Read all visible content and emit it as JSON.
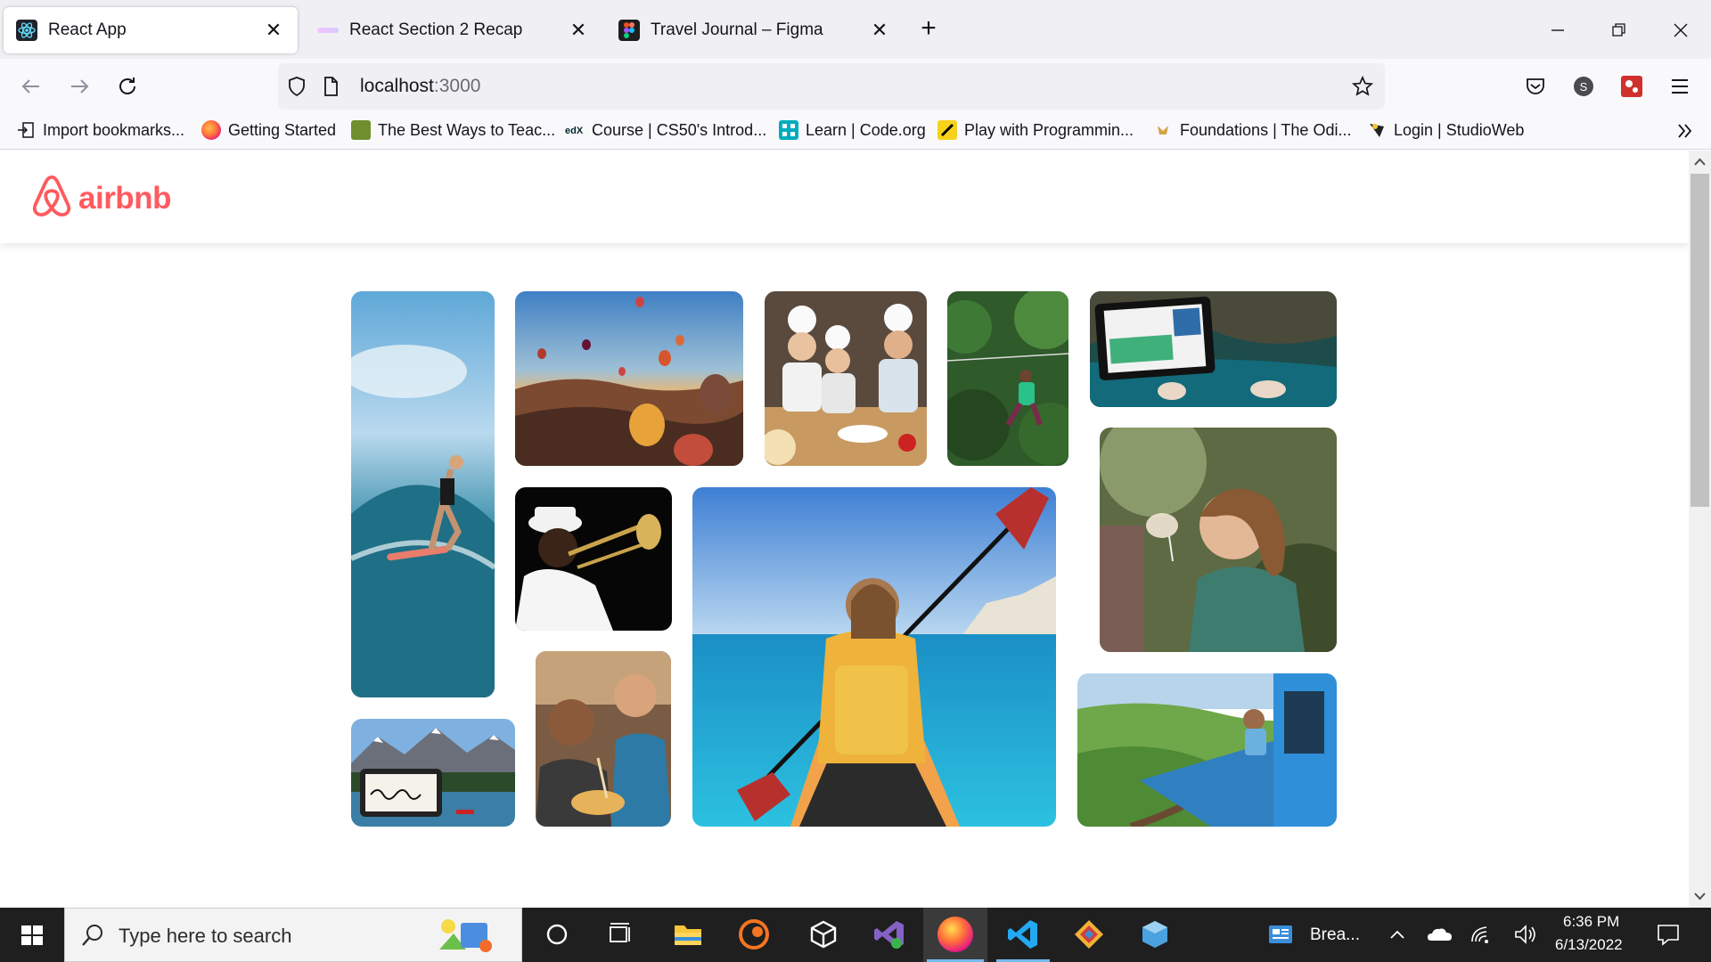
{
  "browser": {
    "tabs": [
      {
        "title": "React App",
        "favicon": "react-icon",
        "active": true
      },
      {
        "title": "React Section 2 Recap",
        "favicon": "scrimba-icon",
        "active": false
      },
      {
        "title": "Travel Journal – Figma",
        "favicon": "figma-icon",
        "active": false
      }
    ],
    "close_glyph": "✕",
    "new_tab_glyph": "+",
    "url": {
      "host": "localhost",
      "port": ":3000"
    },
    "bookmarks": [
      {
        "label": "Import bookmarks...",
        "icon": "import-icon"
      },
      {
        "label": "Getting Started",
        "icon": "firefox-icon"
      },
      {
        "label": "The Best Ways to Teac...",
        "icon": "bookmark-site-icon"
      },
      {
        "label": "Course | CS50's Introd...",
        "icon": "edx-icon"
      },
      {
        "label": "Learn | Code.org",
        "icon": "codeorg-icon"
      },
      {
        "label": "Play with Programmin...",
        "icon": "pencil-icon"
      },
      {
        "label": "Foundations | The Odi...",
        "icon": "odin-icon"
      },
      {
        "label": "Login | StudioWeb",
        "icon": "studioweb-icon"
      }
    ]
  },
  "app": {
    "brand": "airbnb",
    "brand_color": "#FF5A5F",
    "photos": [
      {
        "subject": "surfer"
      },
      {
        "subject": "hot-air-balloons"
      },
      {
        "subject": "kids-cooking"
      },
      {
        "subject": "zipline-forest"
      },
      {
        "subject": "tablet-by-water"
      },
      {
        "subject": "musician-trombone"
      },
      {
        "subject": "kayak"
      },
      {
        "subject": "wine-tasting"
      },
      {
        "subject": "mountain-lake-signature"
      },
      {
        "subject": "friends-eating-noodles"
      },
      {
        "subject": "train-through-hills"
      }
    ]
  },
  "taskbar": {
    "search_placeholder": "Type here to search",
    "pinned_app_label": "Brea...",
    "time": "6:36 PM",
    "date": "6/13/2022"
  }
}
